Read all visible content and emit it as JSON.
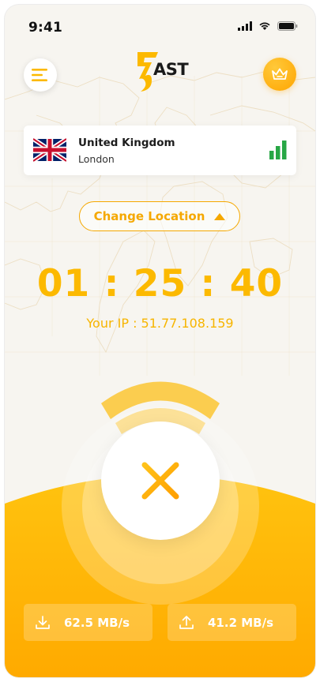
{
  "status_bar": {
    "time": "9:41"
  },
  "header": {
    "logo_text": "AST"
  },
  "location": {
    "country": "United Kingdom",
    "city": "London"
  },
  "change_location_label": "Change Location",
  "timer": "01 : 25 : 40",
  "ip_text": "Your IP : 51.77.108.159",
  "speed": {
    "download": "62.5 MB/s",
    "upload": "41.2 MB/s"
  },
  "colors": {
    "accent": "#fcb900",
    "accent_dark": "#ffa500",
    "signal": "#27a745",
    "bg": "#f7f5f0"
  },
  "icons": {
    "menu": "menu-icon",
    "crown": "crown-icon",
    "flag": "uk-flag-icon",
    "signal": "signal-bars-icon",
    "chevron": "chevron-up-icon",
    "disconnect": "close-icon",
    "download": "download-icon",
    "upload": "upload-icon"
  }
}
